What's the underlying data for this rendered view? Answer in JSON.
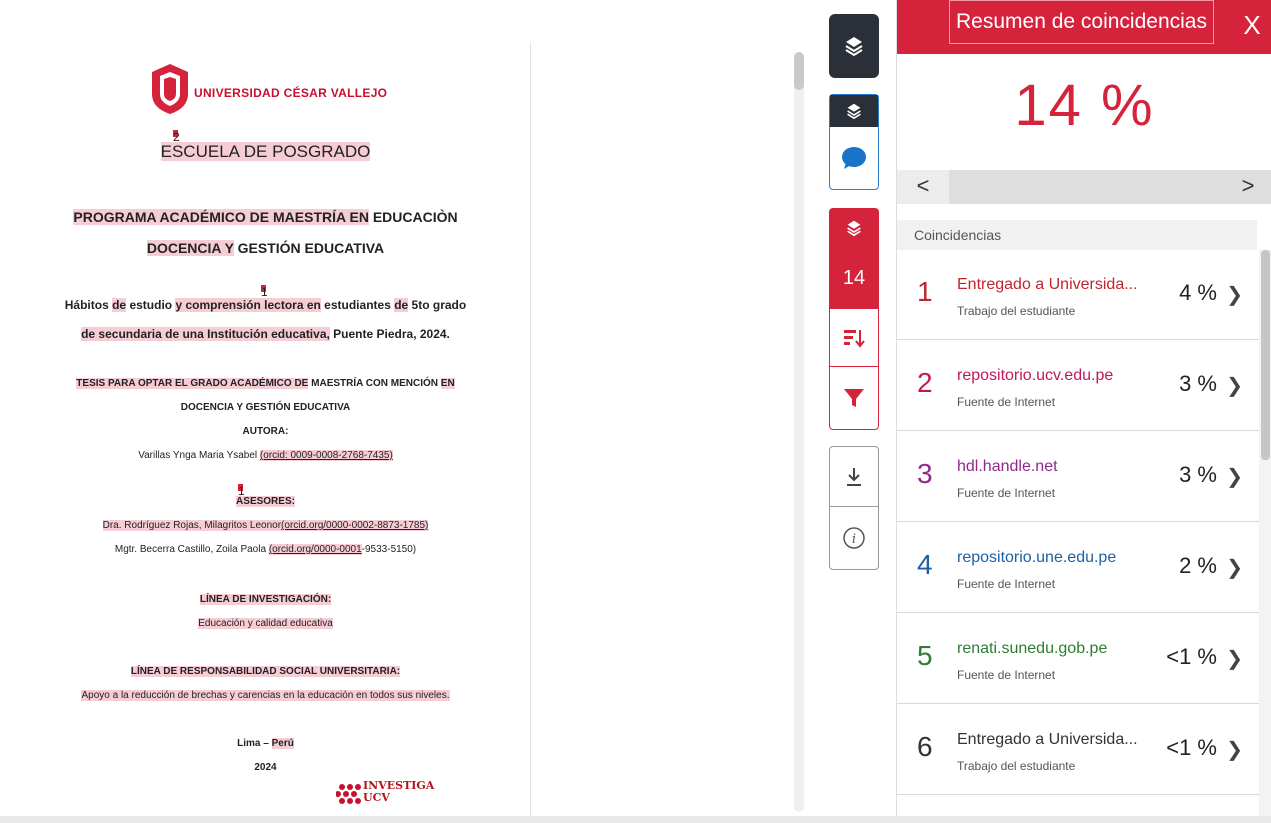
{
  "document": {
    "university": "UNIVERSIDAD CÉSAR VALLEJO",
    "school": "ESCUELA DE POSGRADO",
    "program_line1_a": "PROGRAMA ACADÉMICO DE MAESTRÍA EN",
    "program_line1_b": " EDUCACIÒN",
    "program_line2_a": "DOCENCIA Y",
    "program_line2_b": " GESTIÓN EDUCATIVA",
    "title_line1_a": "Hábitos ",
    "title_line1_b": "de",
    "title_line1_c": " estudio ",
    "title_line1_d": "y comprensión lectora en",
    "title_line1_e": " estudiantes ",
    "title_line1_f": "de",
    "title_line1_g": " 5to grado",
    "title_line2_a": "de secundaria de una Institución educativa,",
    "title_line2_b": " Puente Piedra, 2024.",
    "thesis_line1_a": "TESIS PARA OPTAR EL GRADO ACADÉMICO DE",
    "thesis_line1_b": " MAESTRÍA CON MENCIÓN ",
    "thesis_line1_c": "EN",
    "thesis_line2": "DOCENCIA Y GESTIÓN EDUCATIVA",
    "author_label": "AUTORA:",
    "author_a": "Varillas Ynga Maria Ysabel ",
    "author_b": "(orcid: 0009-0008-2768-7435)",
    "advisors_label": "ASESORES:",
    "advisor1_a": "Dra. Rodríguez Rojas, Milagritos Leonor",
    "advisor1_b": "(orcid.org/0000-0002-8873-1785)",
    "advisor2_a": "Mgtr. Becerra Castillo, Zoila Paola ",
    "advisor2_b": "(orcid.org/0000-0001",
    "advisor2_c": "-9533-5150)",
    "research_line_label": "LÍNEA DE INVESTIGACIÓN:",
    "research_line": "Educación y calidad educativa",
    "social_line_label": "LÍNEA DE RESPONSABILIDAD SOCIAL UNIVERSITARIA:",
    "social_line": "Apoyo a la reducción de brechas y carencias en la educación en todos sus niveles.",
    "city_a": "Lima – ",
    "city_b": "Perú",
    "year": "2024",
    "investiga_line1": "INVESTIGA",
    "investiga_line2": "UCV",
    "markers": [
      "2",
      "1",
      "1",
      "1"
    ]
  },
  "toolbar": {
    "score": "14"
  },
  "panel": {
    "title": "Resumen de coincidencias",
    "close": "X",
    "score": "14 %",
    "nav_prev": "<",
    "nav_next": ">",
    "matches_header": "Coincidencias",
    "matches": [
      {
        "num": "1",
        "title": "Entregado a Universida...",
        "type": "Trabajo del estudiante",
        "pct": "4 %",
        "color": "#c0262d"
      },
      {
        "num": "2",
        "title": "repositorio.ucv.edu.pe",
        "type": "Fuente de Internet",
        "pct": "3 %",
        "color": "#c2185b"
      },
      {
        "num": "3",
        "title": "hdl.handle.net",
        "type": "Fuente de Internet",
        "pct": "3 %",
        "color": "#8e2a8e"
      },
      {
        "num": "4",
        "title": "repositorio.une.edu.pe",
        "type": "Fuente de Internet",
        "pct": "2 %",
        "color": "#1f5fa8"
      },
      {
        "num": "5",
        "title": "renati.sunedu.gob.pe",
        "type": "Fuente de Internet",
        "pct": "<1 %",
        "color": "#2e7d32"
      },
      {
        "num": "6",
        "title": "Entregado a Universida...",
        "type": "Trabajo del estudiante",
        "pct": "<1 %",
        "color": "#333333"
      }
    ]
  },
  "colors": {
    "accent": "#d5233b",
    "toolbar_dark": "#2b2f37",
    "highlight": "#f6cdd5"
  }
}
